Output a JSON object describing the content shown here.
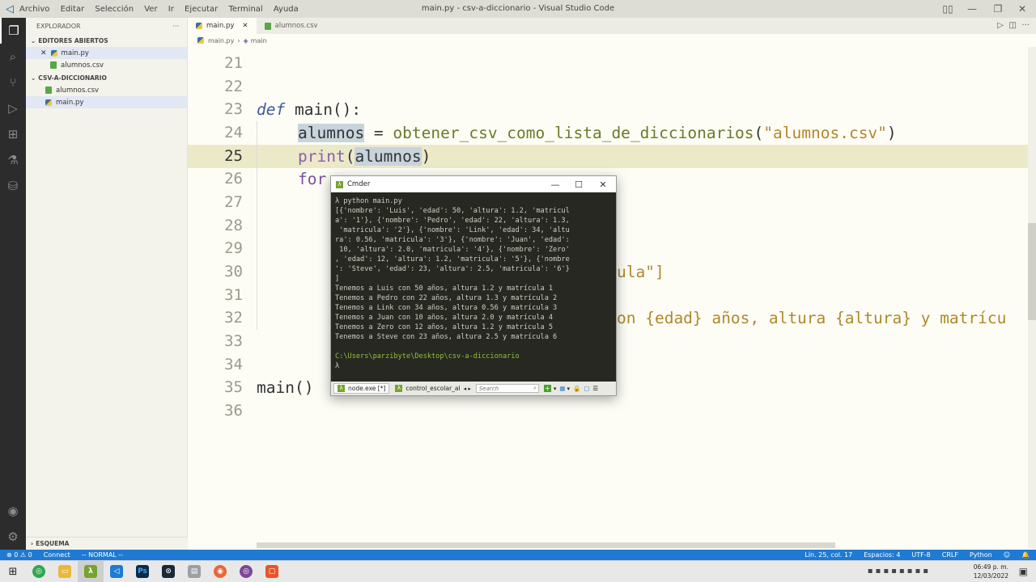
{
  "window": {
    "title": "main.py - csv-a-diccionario - Visual Studio Code",
    "menu": [
      "Archivo",
      "Editar",
      "Selección",
      "Ver",
      "Ir",
      "Ejecutar",
      "Terminal",
      "Ayuda"
    ]
  },
  "sidebar": {
    "title": "EXPLORADOR",
    "more": "···",
    "open_editors_label": "EDITORES ABIERTOS",
    "open_editors": [
      {
        "name": "main.py",
        "icon": "python-file-icon"
      },
      {
        "name": "alumnos.csv",
        "icon": "csv-file-icon"
      }
    ],
    "folder_label": "CSV-A-DICCIONARIO",
    "files": [
      {
        "name": "alumnos.csv",
        "icon": "csv-file-icon"
      },
      {
        "name": "main.py",
        "icon": "python-file-icon"
      }
    ],
    "outline_label": "ESQUEMA"
  },
  "tabs": [
    {
      "label": "main.py",
      "active": true
    },
    {
      "label": "alumnos.csv",
      "active": false
    }
  ],
  "breadcrumb": {
    "file": "main.py",
    "symbol": "main"
  },
  "editor": {
    "line_numbers": [
      "21",
      "22",
      "23",
      "24",
      "25",
      "26",
      "27",
      "28",
      "29",
      "30",
      "31",
      "32",
      "33",
      "34",
      "35",
      "36"
    ],
    "current_line": "25",
    "line23": {
      "kw": "def",
      "rest": " main():"
    },
    "line24": {
      "var": "alumnos",
      "eq": " = ",
      "fn": "obtener_csv_como_lista_de_diccionarios",
      "open": "(",
      "str": "\"alumnos.csv\"",
      "close": ")"
    },
    "line25": {
      "fn": "print",
      "open": "(",
      "arg": "alumnos",
      "close": ")"
    },
    "line26": {
      "text": "for"
    },
    "line30": {
      "text": "ula\"]"
    },
    "line32": {
      "text": "on {edad} años, altura {altura} y matrícu"
    },
    "line35": {
      "text": "main()"
    }
  },
  "cmder": {
    "title": "Cmder",
    "terminal_lines": [
      "λ python main.py",
      "[{'nombre': 'Luis', 'edad': 50, 'altura': 1.2, 'matricul",
      "a': '1'}, {'nombre': 'Pedro', 'edad': 22, 'altura': 1.3,",
      " 'matricula': '2'}, {'nombre': 'Link', 'edad': 34, 'altu",
      "ra': 0.56, 'matricula': '3'}, {'nombre': 'Juan', 'edad':",
      " 10, 'altura': 2.0, 'matricula': '4'}, {'nombre': 'Zero'",
      ", 'edad': 12, 'altura': 1.2, 'matricula': '5'}, {'nombre",
      "': 'Steve', 'edad': 23, 'altura': 2.5, 'matricula': '6'}",
      "]",
      "Tenemos a Luis con 50 años, altura 1.2 y matrícula 1",
      "Tenemos a Pedro con 22 años, altura 1.3 y matrícula 2",
      "Tenemos a Link con 34 años, altura 0.56 y matrícula 3",
      "Tenemos a Juan con 10 años, altura 2.0 y matrícula 4",
      "Tenemos a Zero con 12 años, altura 1.2 y matrícula 5",
      "Tenemos a Steve con 23 años, altura 2.5 y matrícula 6",
      ""
    ],
    "path": "C:\\Users\\parzibyte\\Desktop\\csv-a-diccionario",
    "prompt": "λ",
    "tabs": [
      "node.exe [*]",
      "control_escolar_al"
    ],
    "search_placeholder": "Search"
  },
  "statusbar": {
    "errors": "⊗ 0 ⚠ 0",
    "connect": "Connect",
    "mode": "-- NORMAL --",
    "position": "Lín. 25, col. 17",
    "spaces": "Espacios: 4",
    "encoding": "UTF-8",
    "eol": "CRLF",
    "language": "Python"
  },
  "taskbar": {
    "time": "06:49 p. m.",
    "date": "12/03/2022"
  },
  "colors": {
    "statusbar": "#1f7ad4",
    "current_line": "#ece9c8",
    "terminal_bg": "#272822",
    "terminal_path": "#8fc43a"
  }
}
